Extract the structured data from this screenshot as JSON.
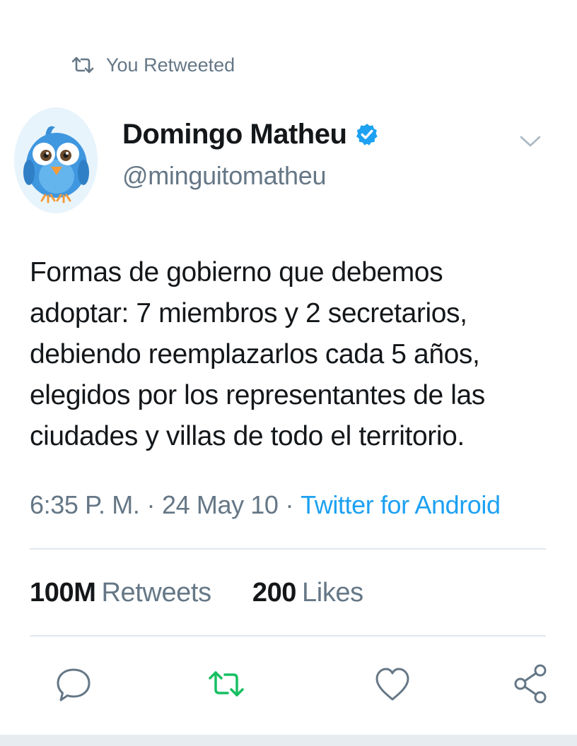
{
  "retweet_context": {
    "label": "You Retweeted",
    "icon": "retweet-icon"
  },
  "author": {
    "display_name": "Domingo Matheu",
    "handle": "@minguitomatheu",
    "verified": true,
    "avatar_icon": "bird-avatar"
  },
  "tweet": {
    "text_lines": [
      "Formas de gobierno que debemos",
      "adoptar: 7 miembros y 2 secretarios,",
      "debiendo reemplazarlos cada 5 años,",
      "elegidos por los representantes de las",
      "ciudades y villas de todo el territorio."
    ],
    "time": "6:35 P. M.",
    "date": "24 May 10",
    "source": "Twitter for Android"
  },
  "stats": {
    "retweets_count": "100M",
    "retweets_label": "Retweets",
    "likes_count": "200",
    "likes_label": "Likes"
  },
  "actions": [
    "reply-icon",
    "retweet-icon",
    "like-icon",
    "share-icon"
  ],
  "colors": {
    "accent": "#1da1f2",
    "retweet_active": "#17bf63",
    "secondary_text": "#657786",
    "primary_text": "#14171a",
    "divider": "#e1e8ed"
  }
}
